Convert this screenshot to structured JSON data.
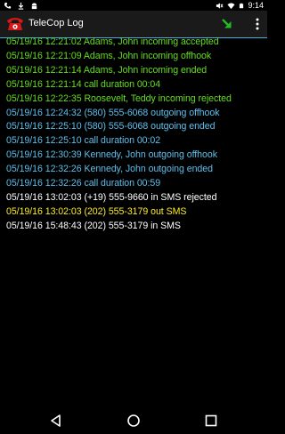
{
  "status_bar": {
    "time": "9:14",
    "left_icons": [
      "phone-icon",
      "download-icon",
      "android-icon"
    ],
    "right_icons": [
      "mute-icon",
      "wifi-icon",
      "battery-icon"
    ]
  },
  "app_bar": {
    "title": "TeleCop Log",
    "app_icon": "telephone-icon",
    "action_icon": "arrow-down-right-icon",
    "overflow_icon": "overflow-menu-icon"
  },
  "colors": {
    "accepted": "#66dd22",
    "outgoing": "#5cc0ee",
    "sms": "#ffffff",
    "sms_out": "#ffee22",
    "divider": "#3cb0e0"
  },
  "log_entries": [
    {
      "text": "05/19/16 12:21:02 Adams, John incoming accepted",
      "color": "#66dd22"
    },
    {
      "text": "05/19/16 12:21:09 Adams, John incoming offhook",
      "color": "#66dd22"
    },
    {
      "text": "05/19/16 12:21:14 Adams, John incoming ended",
      "color": "#66dd22"
    },
    {
      "text": "05/19/16 12:21:14 call duration 00:04",
      "color": "#66dd22"
    },
    {
      "text": "05/19/16 12:22:35 Roosevelt, Teddy incoming rejected",
      "color": "#66dd22"
    },
    {
      "text": "05/19/16 12:24:32 (580) 555-6068 outgoing offhook",
      "color": "#5cc0ee"
    },
    {
      "text": "05/19/16 12:25:10 (580) 555-6068 outgoing ended",
      "color": "#5cc0ee"
    },
    {
      "text": "05/19/16 12:25:10 call duration 00:02",
      "color": "#5cc0ee"
    },
    {
      "text": "05/19/16 12:30:39 Kennedy, John outgoing offhook",
      "color": "#5cc0ee"
    },
    {
      "text": "05/19/16 12:32:26 Kennedy, John outgoing ended",
      "color": "#5cc0ee"
    },
    {
      "text": "05/19/16 12:32:26 call duration 00:59",
      "color": "#5cc0ee"
    },
    {
      "text": "05/19/16 13:02:03 (+19) 555-9660 in SMS rejected",
      "color": "#ffffff"
    },
    {
      "text": "05/19/16 13:02:03 (202) 555-3179 out SMS",
      "color": "#ffee22"
    },
    {
      "text": "05/19/16 15:48:43 (202) 555-3179 in SMS",
      "color": "#ffffff"
    }
  ],
  "nav_bar": {
    "buttons": [
      "back-icon",
      "home-icon",
      "recents-icon"
    ]
  }
}
